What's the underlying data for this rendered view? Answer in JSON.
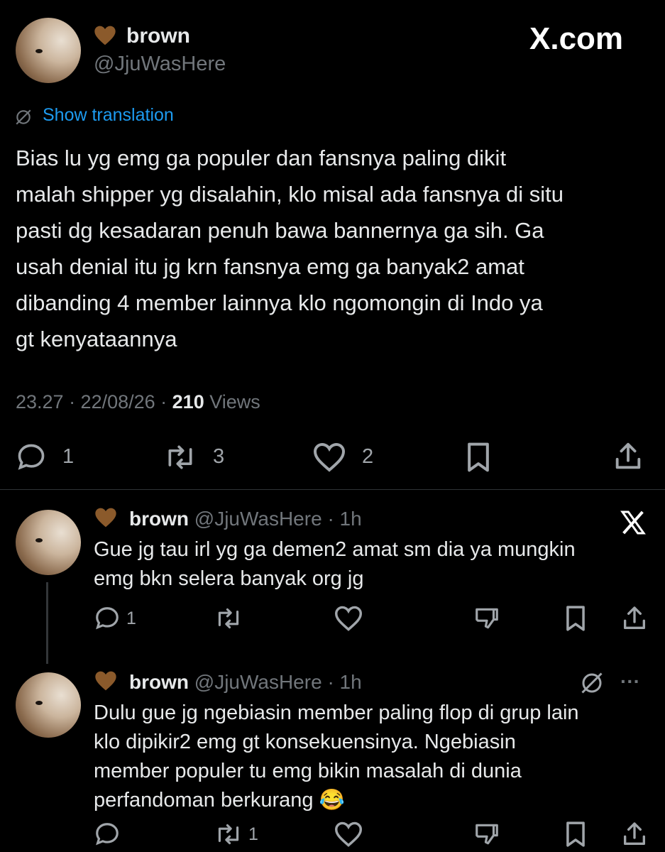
{
  "header": {
    "display_name": "brown",
    "handle": "@JjuWasHere",
    "site_logo": "X.com"
  },
  "main_tweet": {
    "translate_label": "Show translation",
    "text": "Bias lu yg emg ga populer dan fansnya paling dikit\nmalah shipper yg disalahin, klo misal ada fansnya di situ\npasti dg kesadaran penuh bawa bannernya ga sih. Ga\nusah denial itu jg krn fansnya emg ga banyak2 amat\ndibanding 4 member lainnya klo ngomongin di Indo ya\ngt kenyataannya",
    "time": "23.27 · 22/08/26 · ",
    "views_count": "210",
    "views_label": " Views",
    "replies": "1",
    "reposts": "3",
    "likes": "2"
  },
  "replies": [
    {
      "display_name": "brown",
      "handle": "@JjuWasHere",
      "time": "· 1h",
      "text": "Gue jg tau irl yg ga demen2 amat sm dia ya mungkin\nemg bkn selera banyak org jg",
      "replies": "1",
      "reposts": "",
      "corner_icon": "x-logo-icon"
    },
    {
      "display_name": "brown",
      "handle": "@JjuWasHere",
      "time": "· 1h",
      "text": "Dulu gue jg ngebiasin member paling flop di grup lain\nklo dipikir2 emg gt konsekuensinya. Ngebiasin\nmember populer tu emg bikin masalah di dunia\nperfandoman berkurang 😂",
      "replies": "",
      "reposts": "1",
      "more_label": "···"
    }
  ],
  "colors": {
    "background": "#000000",
    "text": "#e7e9ea",
    "secondary": "#71767b",
    "link": "#1d9bf0",
    "heart_emoji": "#8b5a2b"
  }
}
